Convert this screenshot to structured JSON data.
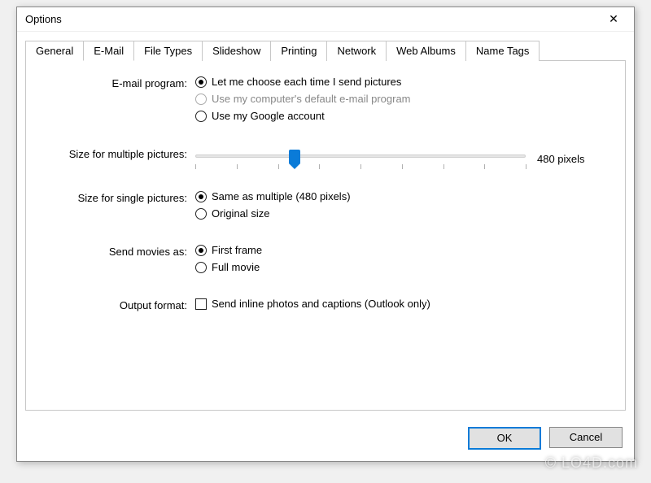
{
  "window": {
    "title": "Options"
  },
  "tabs": [
    {
      "label": "General"
    },
    {
      "label": "E-Mail"
    },
    {
      "label": "File Types"
    },
    {
      "label": "Slideshow"
    },
    {
      "label": "Printing"
    },
    {
      "label": "Network"
    },
    {
      "label": "Web Albums"
    },
    {
      "label": "Name Tags"
    }
  ],
  "email": {
    "program_label": "E-mail program:",
    "program_options": {
      "choose": "Let me choose each time I send pictures",
      "default": "Use my computer's default e-mail program",
      "google": "Use my Google account"
    },
    "multi_label": "Size for multiple pictures:",
    "multi_value": "480 pixels",
    "slider_percent": 30,
    "single_label": "Size for single pictures:",
    "single_options": {
      "same": "Same as multiple (480 pixels)",
      "original": "Original size"
    },
    "movies_label": "Send movies as:",
    "movies_options": {
      "first": "First frame",
      "full": "Full movie"
    },
    "output_label": "Output format:",
    "output_check": "Send inline photos and captions (Outlook only)"
  },
  "buttons": {
    "ok": "OK",
    "cancel": "Cancel"
  },
  "watermark": "© LO4D.com"
}
